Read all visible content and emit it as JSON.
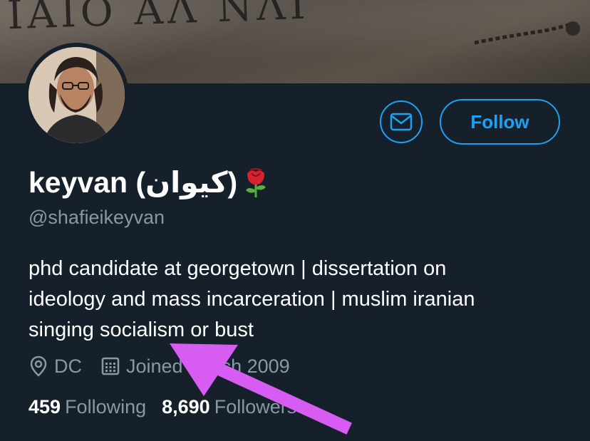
{
  "banner": {
    "graffiti_text": "ΙΑΙΟ ΑΛ ΝΛΙ"
  },
  "actions": {
    "follow_label": "Follow"
  },
  "profile": {
    "display_name": "keyvan (کیوان)",
    "handle": "@shafieikeyvan",
    "bio_lines": [
      "phd candidate at georgetown | dissertation on",
      "ideology and mass incarceration | muslim iranian",
      "singing socialism or bust"
    ],
    "location": "DC",
    "joined": "Joined March 2009"
  },
  "stats": {
    "following_count": "459",
    "following_label": "Following",
    "followers_count": "8,690",
    "followers_label": "Followers"
  },
  "colors": {
    "accent": "#1da1f2",
    "background": "#15202b",
    "secondary_text": "#8899a6",
    "annotation_arrow": "#d65cf2"
  },
  "icons": [
    "mail-icon",
    "location-pin-icon",
    "calendar-icon",
    "rose-emoji"
  ]
}
